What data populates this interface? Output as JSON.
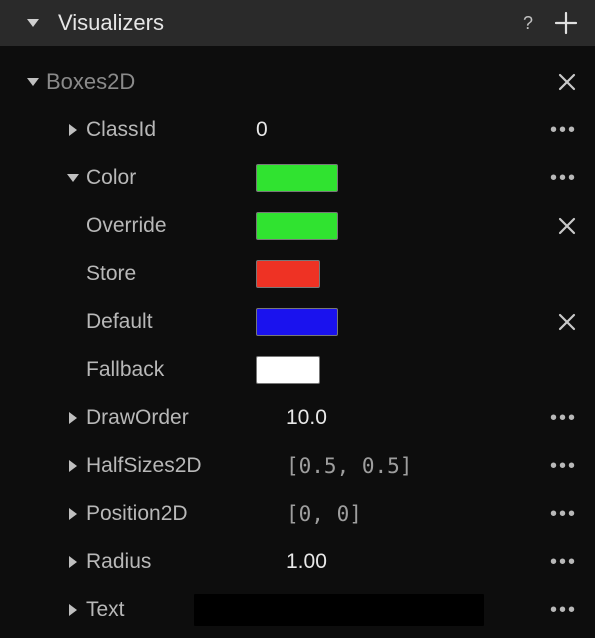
{
  "header": {
    "title": "Visualizers",
    "help": "?"
  },
  "entity": {
    "name": "Boxes2D"
  },
  "props": {
    "classid": {
      "label": "ClassId",
      "value": "0"
    },
    "color": {
      "label": "Color",
      "swatch": "#30e330",
      "override": {
        "label": "Override",
        "swatch": "#30e330"
      },
      "store": {
        "label": "Store",
        "swatch": "#ee3224"
      },
      "default": {
        "label": "Default",
        "swatch": "#1a12ee"
      },
      "fallback": {
        "label": "Fallback",
        "swatch": "#ffffff"
      }
    },
    "draworder": {
      "label": "DrawOrder",
      "value": "10.0"
    },
    "halfsizes": {
      "label": "HalfSizes2D",
      "value": "[0.5, 0.5]"
    },
    "position": {
      "label": "Position2D",
      "value": "[0, 0]"
    },
    "radius": {
      "label": "Radius",
      "value": "1.00"
    },
    "text": {
      "label": "Text"
    }
  }
}
